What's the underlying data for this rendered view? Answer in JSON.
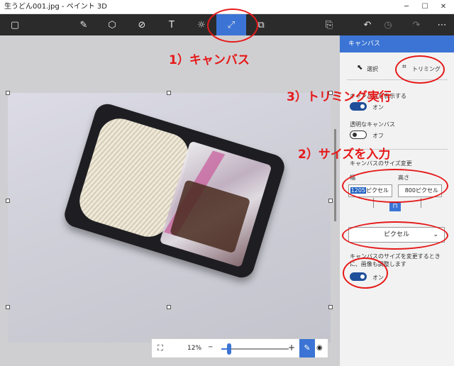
{
  "window": {
    "title": "生うどん001.jpg - ペイント 3D",
    "minimize": "─",
    "maximize": "☐",
    "close": "✕"
  },
  "toolbar": {
    "menu_icon": "▢",
    "brush_icon": "✎",
    "shapes3d_icon": "⬡",
    "stickers_icon": "⊘",
    "text_icon": "T",
    "effects_icon": "☼",
    "canvas_icon": "⤢",
    "library_icon": "⧉",
    "paste_icon": "⎘",
    "undo_icon": "↶",
    "history_icon": "◷",
    "redo_icon": "↷",
    "more_icon": "⋯"
  },
  "panel": {
    "header": "キャンバス",
    "select_label": "選択",
    "crop_label": "トリミング",
    "show_canvas_label": "キャンバスを表示する",
    "show_canvas_state": "オン",
    "transparent_label": "透明なキャンバス",
    "transparent_state": "オフ",
    "resize_label": "キャンバスのサイズ変更",
    "width_label": "幅",
    "height_label": "高さ",
    "width_value": "1205",
    "width_unit": "ピクセル",
    "height_value": "800ピクセル",
    "lock_icon": "⊓",
    "unit_select": "ピクセル",
    "resize_image_label": "キャンバスのサイズを変更するときに、画像も調整します",
    "resize_image_state": "オン"
  },
  "zoom": {
    "fit_icon": "⛶",
    "value": "12%",
    "minus": "─",
    "plus": "+",
    "level": 0.12,
    "pen_icon": "✎",
    "view_icon": "◉"
  },
  "annotations": {
    "step1": "1）キャンバス",
    "step2": "2）サイズを入力",
    "step3": "3）トリミング実行"
  },
  "colors": {
    "accent": "#3b74d4",
    "annotation": "#e61919",
    "toolbar": "#2b2b2b"
  }
}
